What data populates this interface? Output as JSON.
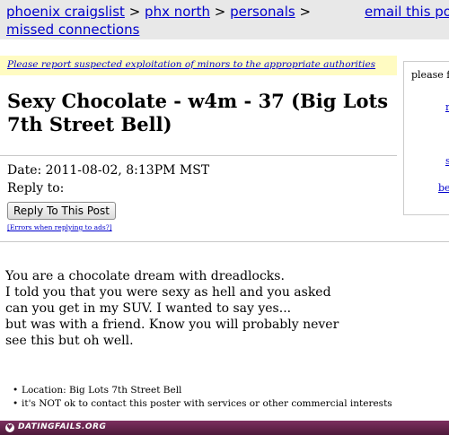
{
  "breadcrumb": {
    "items": [
      "phoenix craigslist",
      "phx north",
      "personals",
      "missed connections"
    ],
    "separator": ">"
  },
  "email_link": "email this post",
  "warning": "Please report suspected exploitation of minors to the appropriate authorities",
  "sidebar": {
    "label": "please fl",
    "flags": [
      "n",
      "s",
      "be"
    ]
  },
  "post": {
    "title": "Sexy Chocolate - w4m - 37 (Big Lots 7th Street Bell)",
    "date": "Date: 2011-08-02,  8:13PM MST",
    "reply_to": "Reply to:",
    "reply_button": "Reply To This Post",
    "errors_link": "[Errors when replying to ads?]",
    "body_lines": [
      "You are a chocolate dream with dreadlocks.",
      "I told you that you were sexy as hell and you asked",
      "can you get in my SUV. I wanted to say yes...",
      "but was with a friend. Know you will probably never",
      "see this but oh well."
    ],
    "details": [
      "Location: Big Lots 7th Street Bell",
      "it's NOT ok to contact this poster with services or other commercial interests"
    ]
  },
  "footer": {
    "brand": "DATINGFAILS.ORG"
  },
  "colors": {
    "link": "#0000cc",
    "warning_bg": "#fffbc2",
    "topbar_bg": "#e8e8e8",
    "footer_bg": "#6a2650"
  }
}
